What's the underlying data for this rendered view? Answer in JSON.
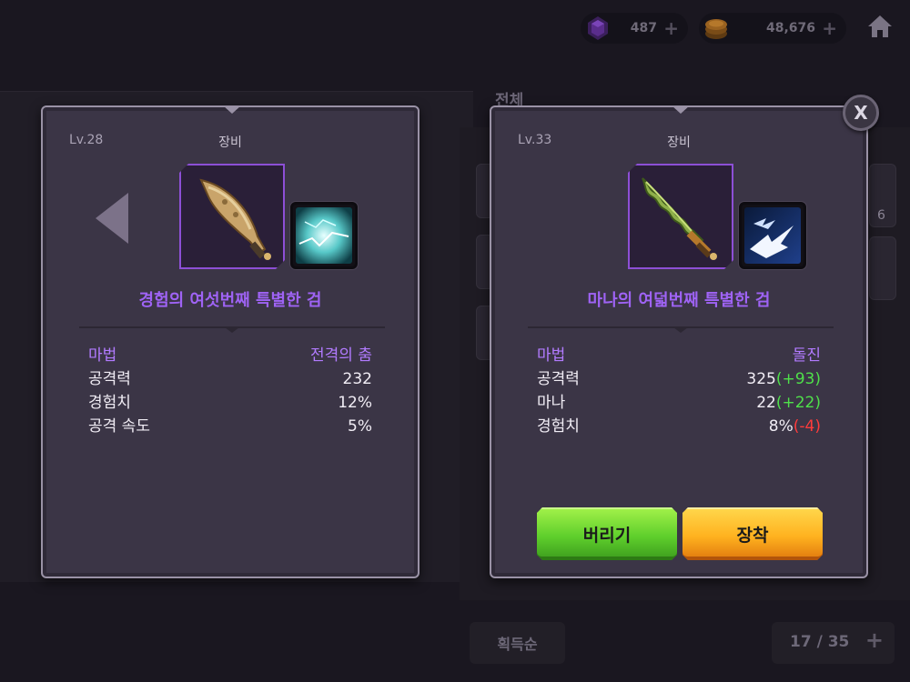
{
  "topbar": {
    "gems": {
      "value": "487",
      "icon": "gem-icon"
    },
    "coins": {
      "value": "48,676",
      "icon": "coin-icon"
    },
    "home_icon": "home-icon"
  },
  "background": {
    "tab_all_label": "전체",
    "sort_button_label": "획득순",
    "page_indicator": "17 / 35",
    "side_count": "6"
  },
  "left_panel": {
    "level": "Lv.28",
    "kind": "장비",
    "item_name": "경험의 여섯번째 특별한 검",
    "name_color": "#9f63f5",
    "stats": [
      {
        "label": "마법",
        "value": "전격의 춤",
        "magic": true
      },
      {
        "label": "공격력",
        "value": "232"
      },
      {
        "label": "경험치",
        "value": "12%"
      },
      {
        "label": "공격 속도",
        "value": "5%"
      }
    ]
  },
  "right_panel": {
    "level": "Lv.33",
    "kind": "장비",
    "item_name": "마나의 여덟번째 특별한 검",
    "stats": [
      {
        "label": "마법",
        "value": "돌진",
        "magic": true
      },
      {
        "label": "공격력",
        "value": "325",
        "delta": "(+93)",
        "delta_type": "up"
      },
      {
        "label": "마나",
        "value": "22",
        "delta": "(+22)",
        "delta_type": "up"
      },
      {
        "label": "경험치",
        "value": "8%",
        "delta": "(-4)",
        "delta_type": "down"
      }
    ],
    "discard_label": "버리기",
    "equip_label": "장착"
  },
  "close_label": "X",
  "colors": {
    "magic": "#b27bff",
    "increase": "#4fe04a",
    "decrease": "#ff3b3b",
    "discard_button": "#5fcf2c",
    "equip_button": "#ffb21f"
  }
}
